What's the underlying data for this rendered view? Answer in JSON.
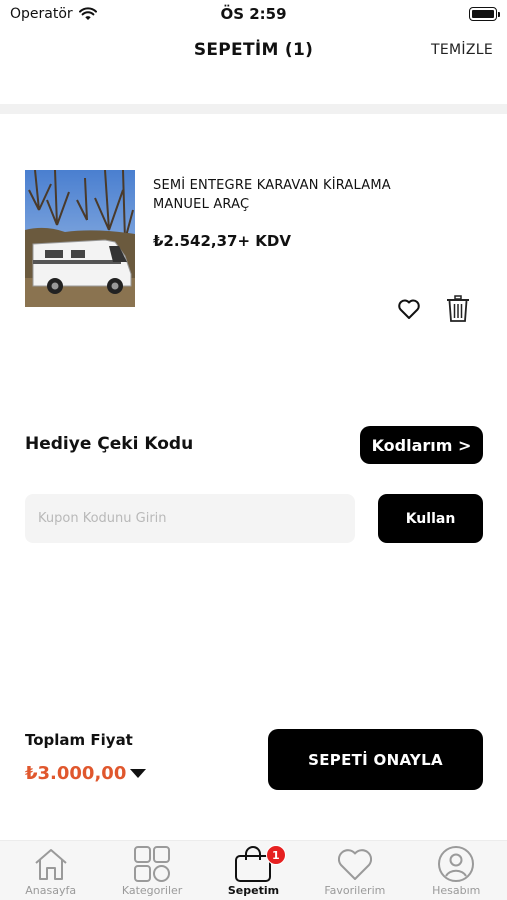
{
  "status_bar": {
    "carrier": "Operatör",
    "time": "ÖS 2:59"
  },
  "header": {
    "title": "SEPETİM (1)",
    "clear_label": "TEMİZLE"
  },
  "cart_items": [
    {
      "title": "SEMİ ENTEGRE KARAVAN KİRALAMA MANUEL ARAÇ",
      "price": "₺2.542,37+ KDV",
      "image_icon": "camper-van-photo"
    }
  ],
  "gift_code": {
    "label": "Hediye Çeki Kodu",
    "codes_button": "Kodlarım >",
    "input_value": "",
    "input_placeholder": "Kupon Kodunu Girin",
    "apply_button": "Kullan"
  },
  "summary": {
    "total_label": "Toplam Fiyat",
    "total_value": "₺3.000,00",
    "confirm_button": "SEPETİ ONAYLA"
  },
  "tab_bar": {
    "tabs": [
      {
        "label": "Anasayfa",
        "icon": "home-icon"
      },
      {
        "label": "Kategoriler",
        "icon": "categories-icon"
      },
      {
        "label": "Sepetim",
        "icon": "bag-icon",
        "badge": "1",
        "active": true
      },
      {
        "label": "Favorilerim",
        "icon": "heart-icon"
      },
      {
        "label": "Hesabım",
        "icon": "account-icon"
      }
    ]
  },
  "colors": {
    "accent_price": "#e0572d",
    "primary_button": "#000000",
    "badge": "#e62020"
  }
}
